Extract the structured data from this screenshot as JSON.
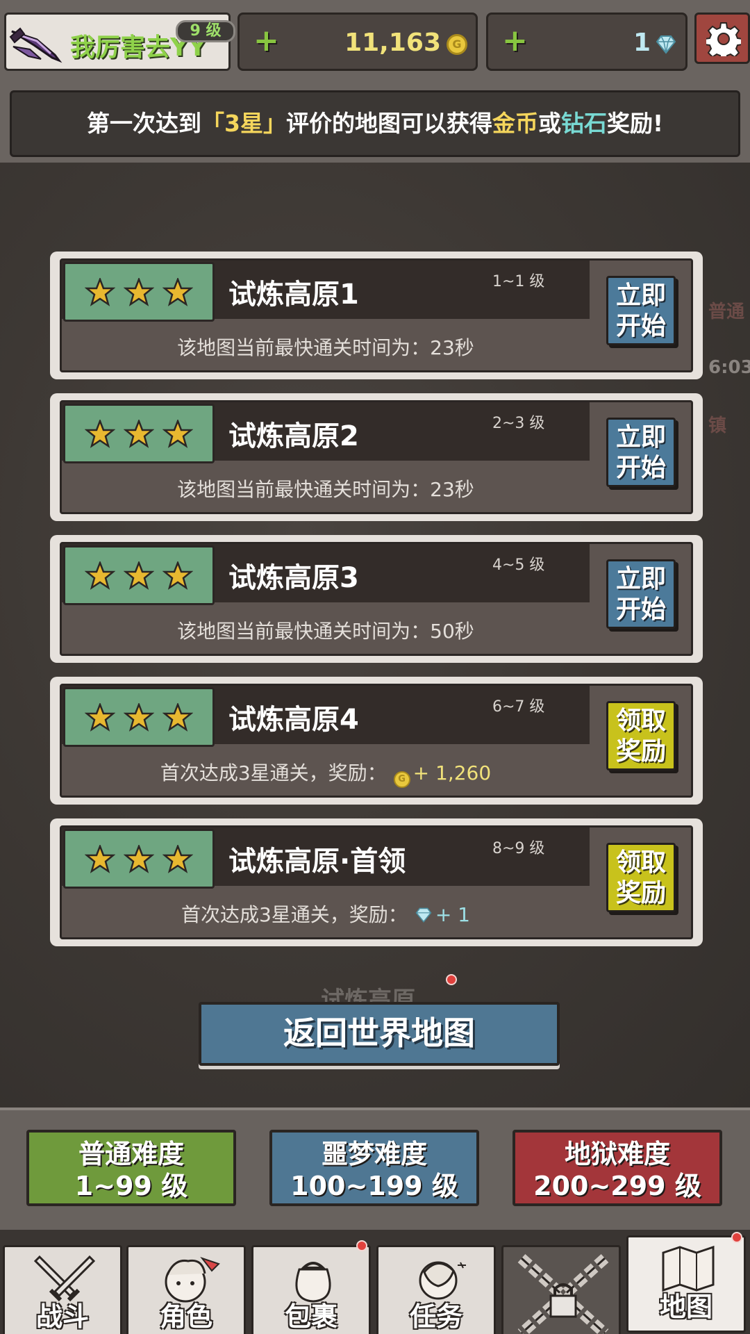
{
  "header": {
    "player_name": "我厉害去YY",
    "level_badge": "9 级",
    "coins": "11,163",
    "gems": "1",
    "coin_symbol": "G"
  },
  "banner": {
    "part1": "第一次达到",
    "star_text": "「3星」",
    "part2": "评价的地图可以获得",
    "gold_text": "金币",
    "part3": "或",
    "gem_text": "钻石",
    "part4": "奖励!"
  },
  "map_labels": {
    "side_top": "普通",
    "side_time": "6:03",
    "side_bottom": "镇",
    "under_title": "试炼高原"
  },
  "stages": [
    {
      "title": "试炼高原1",
      "level": "1~1 级",
      "info": "该地图当前最快通关时间为：23秒",
      "button_line1": "立即",
      "button_line2": "开始",
      "stars": 3
    },
    {
      "title": "试炼高原2",
      "level": "2~3 级",
      "info": "该地图当前最快通关时间为：23秒",
      "button_line1": "立即",
      "button_line2": "开始",
      "stars": 3
    },
    {
      "title": "试炼高原3",
      "level": "4~5 级",
      "info": "该地图当前最快通关时间为：50秒",
      "button_line1": "立即",
      "button_line2": "开始",
      "stars": 3
    },
    {
      "title": "试炼高原4",
      "level": "6~7 级",
      "info": "首次达成3星通关，奖励：",
      "reward": "+ 1,260",
      "button_line1": "领取",
      "button_line2": "奖励",
      "stars": 3
    },
    {
      "title": "试炼高原·首领",
      "level": "8~9 级",
      "info": "首次达成3星通关，奖励：",
      "reward": "+ 1",
      "button_line1": "领取",
      "button_line2": "奖励",
      "stars": 3
    }
  ],
  "return_button": "返回世界地图",
  "difficulty": [
    {
      "name": "普通难度",
      "range": "1~99 级"
    },
    {
      "name": "噩梦难度",
      "range": "100~199 级"
    },
    {
      "name": "地狱难度",
      "range": "200~299 级"
    }
  ],
  "nav": [
    {
      "label": "战斗",
      "icon": "swords-icon"
    },
    {
      "label": "角色",
      "icon": "character-icon"
    },
    {
      "label": "包裹",
      "icon": "bag-icon"
    },
    {
      "label": "任务",
      "icon": "quest-icon"
    },
    {
      "label": "",
      "icon": "chains-lock-icon"
    },
    {
      "label": "地图",
      "icon": "map-icon"
    }
  ],
  "colors": {
    "accent_green": "#8fd14a",
    "gold": "#f5d65c",
    "gem": "#78d9d3",
    "start_button": "#4c7a9a",
    "claim_button": "#c8c21c"
  }
}
